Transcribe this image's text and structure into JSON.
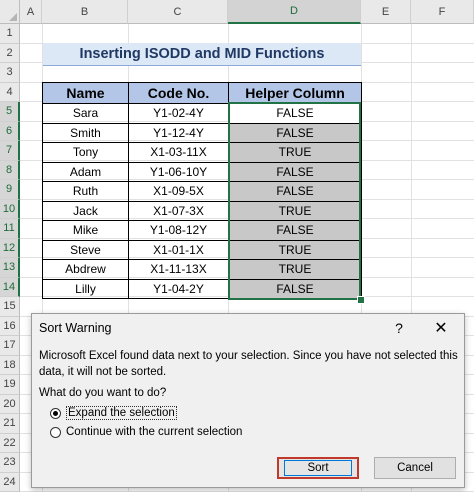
{
  "columns": [
    "A",
    "B",
    "C",
    "D",
    "E",
    "F"
  ],
  "rows": [
    "1",
    "2",
    "3",
    "4",
    "5",
    "6",
    "7",
    "8",
    "9",
    "10",
    "11",
    "12",
    "13",
    "14",
    "15",
    "16",
    "17",
    "18",
    "19",
    "20",
    "21",
    "22",
    "23",
    "24"
  ],
  "title": "Inserting ISODD and MID Functions",
  "table": {
    "headers": [
      "Name",
      "Code No.",
      "Helper Column"
    ],
    "rows": [
      [
        "Sara",
        "Y1-02-4Y",
        "FALSE"
      ],
      [
        "Smith",
        "Y1-12-4Y",
        "FALSE"
      ],
      [
        "Tony",
        "X1-03-11X",
        "TRUE"
      ],
      [
        "Adam",
        "Y1-06-10Y",
        "FALSE"
      ],
      [
        "Ruth",
        "X1-09-5X",
        "FALSE"
      ],
      [
        "Jack",
        "X1-07-3X",
        "TRUE"
      ],
      [
        "Mike",
        "Y1-08-12Y",
        "FALSE"
      ],
      [
        "Steve",
        "X1-01-1X",
        "TRUE"
      ],
      [
        "Abdrew",
        "X1-11-13X",
        "TRUE"
      ],
      [
        "Lilly",
        "Y1-04-2Y",
        "FALSE"
      ]
    ]
  },
  "dialog": {
    "title": "Sort Warning",
    "help": "?",
    "close": "✕",
    "message": "Microsoft Excel found data next to your selection.  Since you have not selected this data, it will not be sorted.",
    "question": "What do you want to do?",
    "options": [
      "Expand the selection",
      "Continue with the current selection"
    ],
    "selected_option": 0,
    "sort_label": "Sort",
    "cancel_label": "Cancel"
  },
  "colors": {
    "selection": "#217346",
    "header_fill": "#b4c6e7",
    "title_fill": "#dce8f6",
    "helper_fill": "#c8c8c8"
  }
}
